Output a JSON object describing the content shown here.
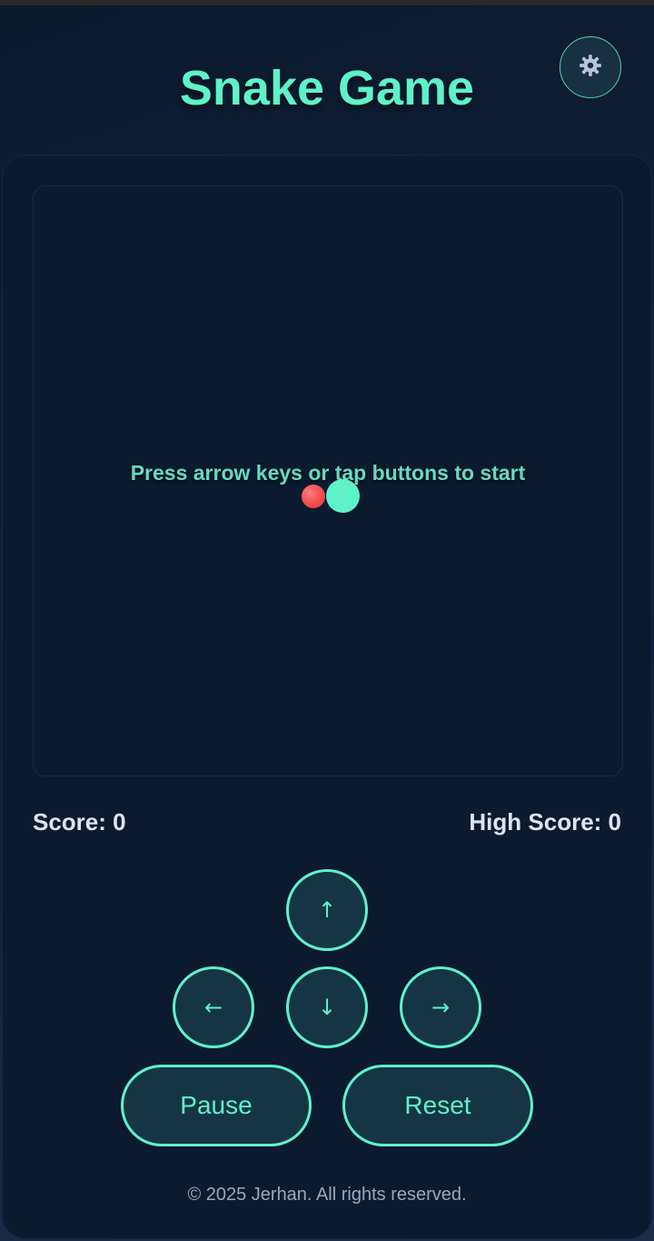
{
  "header": {
    "title": "Snake Game",
    "settings_icon": "gear-icon"
  },
  "board": {
    "message": "Press arrow keys or tap buttons to start",
    "food_color": "#f24a4a",
    "snake_color": "#5ef2c8"
  },
  "scores": {
    "score_label": "Score: 0",
    "high_score_label": "High Score: 0"
  },
  "controls": {
    "up": "↑",
    "left": "←",
    "down": "↓",
    "right": "→",
    "pause": "Pause",
    "reset": "Reset"
  },
  "footer": {
    "copyright": "© 2025 Jerhan. All rights reserved."
  },
  "colors": {
    "accent": "#5ef2c8",
    "background": "#0b1a2e",
    "button_fill": "#153545"
  }
}
